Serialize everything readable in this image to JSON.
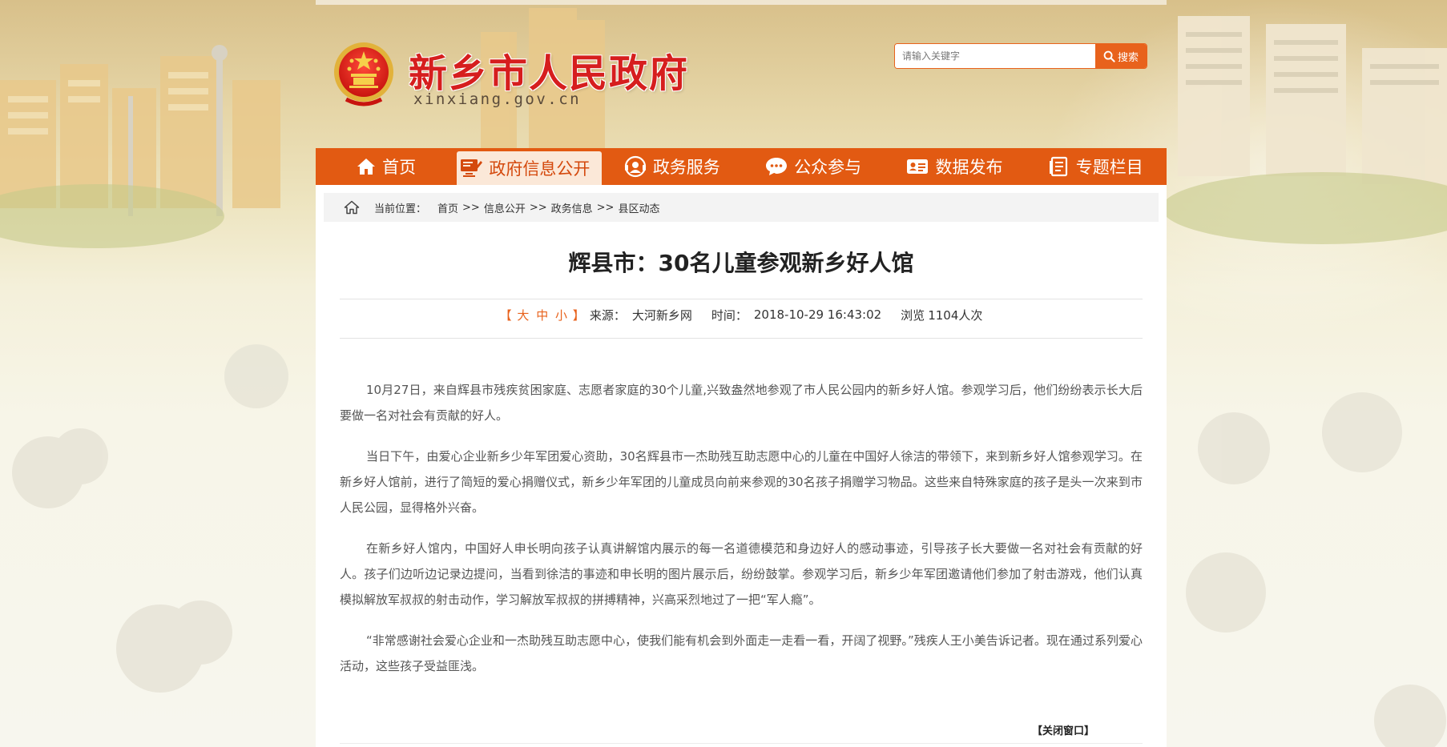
{
  "site": {
    "name": "新乡市人民政府",
    "domain": "xinxiang.gov.cn"
  },
  "search": {
    "placeholder": "请输入关键字",
    "button_label": "搜索"
  },
  "nav": {
    "items": [
      {
        "label": "首页",
        "icon": "home-icon"
      },
      {
        "label": "政府信息公开",
        "icon": "computer-edit-icon",
        "active": true
      },
      {
        "label": "政务服务",
        "icon": "service-icon"
      },
      {
        "label": "公众参与",
        "icon": "chat-icon"
      },
      {
        "label": "数据发布",
        "icon": "id-card-icon"
      },
      {
        "label": "专题栏目",
        "icon": "document-icon"
      }
    ]
  },
  "breadcrumb": {
    "prefix": "当前位置：",
    "items": [
      "首页",
      "信息公开",
      "政务信息",
      "县区动态"
    ],
    "separator": ">>"
  },
  "article": {
    "title": "辉县市：30名儿童参观新乡好人馆",
    "font_sizes": {
      "open": "【",
      "large": "大",
      "medium": "中",
      "small": "小",
      "close": "】"
    },
    "source_label": "来源：",
    "source": "大河新乡网",
    "time_label": "时间：",
    "time": "2018-10-29 16:43:02",
    "views_label": "浏览",
    "views": "1104人次",
    "paragraphs": [
      "10月27日，来自辉县市残疾贫困家庭、志愿者家庭的30个儿童,兴致盎然地参观了市人民公园内的新乡好人馆。参观学习后，他们纷纷表示长大后要做一名对社会有贡献的好人。",
      "当日下午，由爱心企业新乡少年军团爱心资助，30名辉县市一杰助残互助志愿中心的儿童在中国好人徐洁的带领下，来到新乡好人馆参观学习。在新乡好人馆前，进行了简短的爱心捐赠仪式，新乡少年军团的儿童成员向前来参观的30名孩子捐赠学习物品。这些来自特殊家庭的孩子是头一次来到市人民公园，显得格外兴奋。",
      "在新乡好人馆内，中国好人申长明向孩子认真讲解馆内展示的每一名道德模范和身边好人的感动事迹，引导孩子长大要做一名对社会有贡献的好人。孩子们边听边记录边提问，当看到徐洁的事迹和申长明的图片展示后，纷纷鼓掌。参观学习后，新乡少年军团邀请他们参加了射击游戏，他们认真模拟解放军叔叔的射击动作，学习解放军叔叔的拼搏精神，兴高采烈地过了一把“军人瘾”。",
      "“非常感谢社会爱心企业和一杰助残互助志愿中心，使我们能有机会到外面走一走看一看，开阔了视野。”残疾人王小美告诉记者。现在通过系列爱心活动，这些孩子受益匪浅。"
    ],
    "close_window": "【关闭窗口】"
  },
  "colors": {
    "nav_bg": "#e25a12",
    "accent": "#e8621c",
    "title_red": "#d61e1e"
  }
}
